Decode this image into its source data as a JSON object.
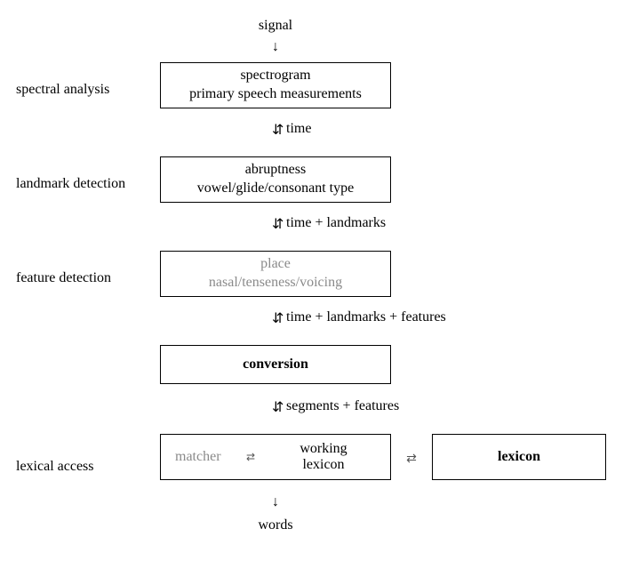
{
  "top": {
    "signal": "signal"
  },
  "side": {
    "spectral": "spectral analysis",
    "landmark": "landmark detection",
    "feature": "feature detection",
    "lexical": "lexical access"
  },
  "boxes": {
    "spectral": {
      "l1": "spectrogram",
      "l2": "primary speech measurements"
    },
    "landmark": {
      "l1": "abruptness",
      "l2": "vowel/glide/consonant type"
    },
    "feature": {
      "l1": "place",
      "l2": "nasal/tenseness/voicing"
    },
    "conversion": {
      "l1": "conversion"
    },
    "lexbox": {
      "matcher": "matcher",
      "working1": "working",
      "working2": "lexicon"
    },
    "lexicon": {
      "l1": "lexicon"
    }
  },
  "connectors": {
    "c1": "time",
    "c2": "time + landmarks",
    "c3": "time + landmarks + features",
    "c4": "segments + features"
  },
  "bottom": {
    "words": "words"
  },
  "glyphs": {
    "down": "↓",
    "updown": "⇵",
    "leftright": "⇄"
  }
}
